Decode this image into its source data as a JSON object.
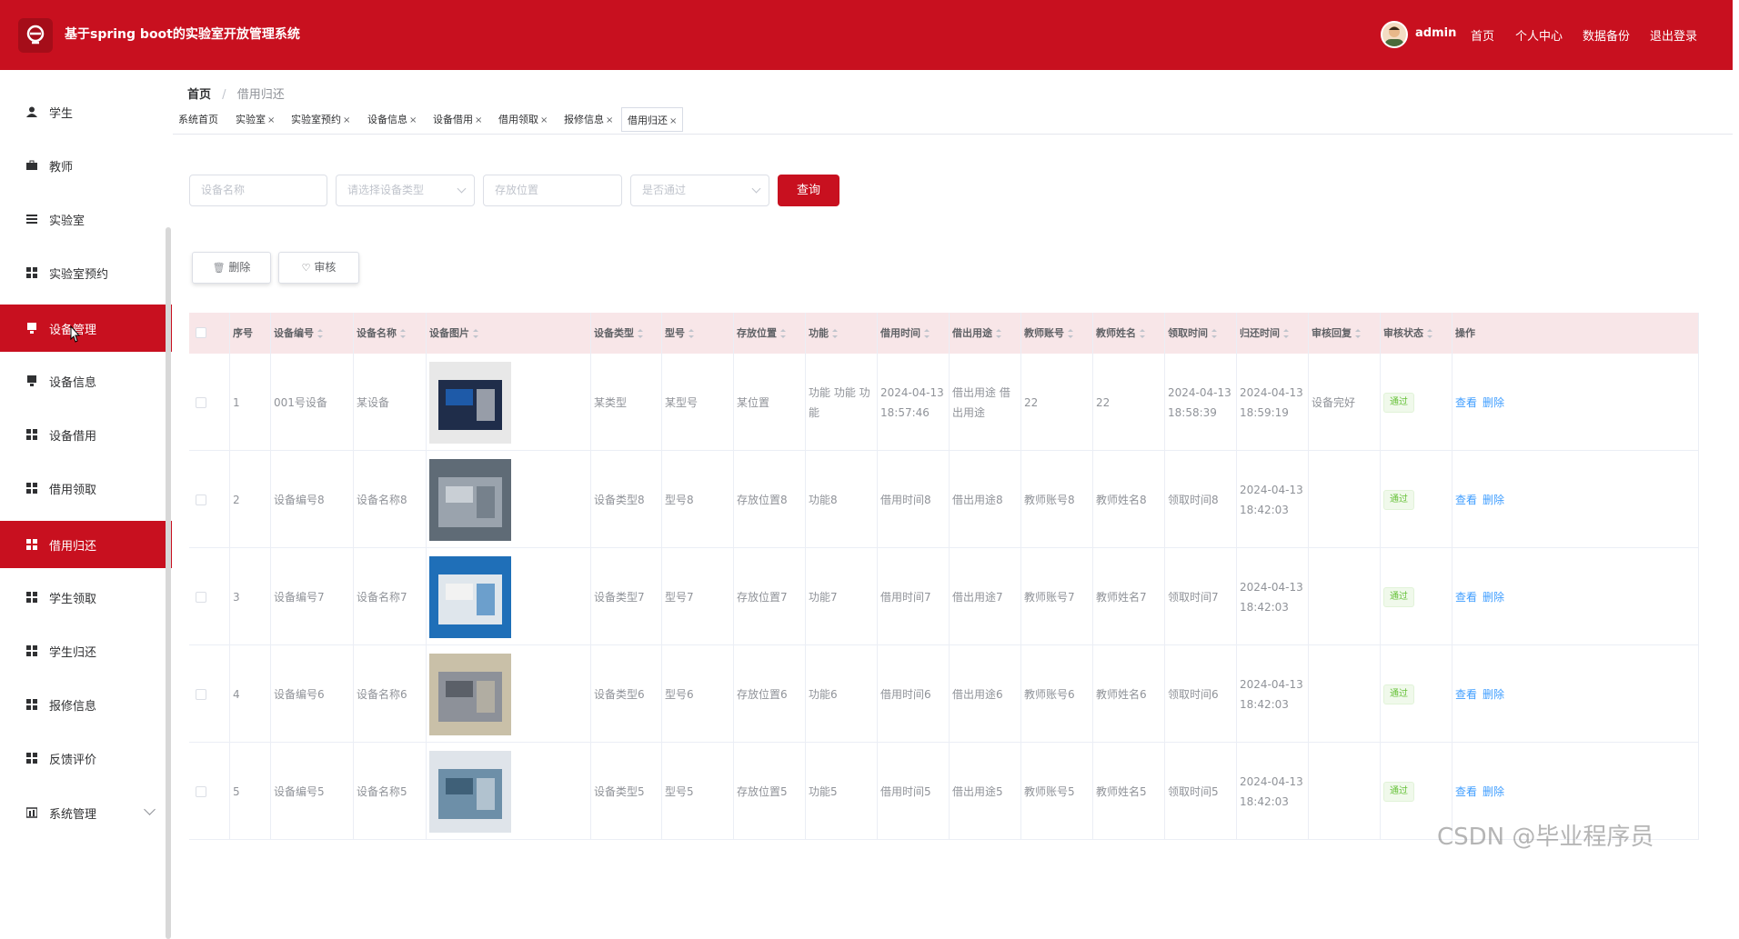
{
  "app_title": "基于spring boot的实验室开放管理系统",
  "header": {
    "username": "admin",
    "links": [
      "首页",
      "个人中心",
      "数据备份",
      "退出登录"
    ]
  },
  "sidebar": {
    "items": [
      {
        "label": "学生",
        "icon": "user-icon"
      },
      {
        "label": "教师",
        "icon": "briefcase-icon"
      },
      {
        "label": "实验室",
        "icon": "list-icon"
      },
      {
        "label": "实验室预约",
        "icon": "grid-icon"
      },
      {
        "label": "设备管理",
        "icon": "folder-icon",
        "active": true
      },
      {
        "label": "设备信息",
        "icon": "folder-icon"
      },
      {
        "label": "设备借用",
        "icon": "grid-icon"
      },
      {
        "label": "借用领取",
        "icon": "grid-icon"
      },
      {
        "label": "借用归还",
        "icon": "grid-icon",
        "active": true
      },
      {
        "label": "学生领取",
        "icon": "grid-icon"
      },
      {
        "label": "学生归还",
        "icon": "grid-icon"
      },
      {
        "label": "报修信息",
        "icon": "grid-icon"
      },
      {
        "label": "反馈评价",
        "icon": "grid-icon"
      },
      {
        "label": "系统管理",
        "icon": "chart-icon",
        "has_arrow": true
      }
    ]
  },
  "breadcrumb": {
    "home": "首页",
    "separator": "/",
    "current": "借用归还"
  },
  "tabs": [
    {
      "label": "系统首页",
      "closable": false
    },
    {
      "label": "实验室",
      "closable": true
    },
    {
      "label": "实验室预约",
      "closable": true
    },
    {
      "label": "设备信息",
      "closable": true
    },
    {
      "label": "设备借用",
      "closable": true
    },
    {
      "label": "借用领取",
      "closable": true
    },
    {
      "label": "报修信息",
      "closable": true
    },
    {
      "label": "借用归还",
      "closable": true,
      "active": true
    }
  ],
  "search": {
    "name_placeholder": "设备名称",
    "type_placeholder": "请选择设备类型",
    "location_placeholder": "存放位置",
    "approved_placeholder": "是否通过",
    "query_button": "查询"
  },
  "actions": {
    "delete": "删除",
    "review": "审核"
  },
  "table": {
    "columns": [
      "序号",
      "设备编号",
      "设备名称",
      "设备图片",
      "设备类型",
      "型号",
      "存放位置",
      "功能",
      "借用时间",
      "借出用途",
      "教师账号",
      "教师姓名",
      "领取时间",
      "归还时间",
      "审核回复",
      "审核状态",
      "操作"
    ],
    "rows": [
      {
        "index": "1",
        "code": "001号设备",
        "name": "某设备",
        "type": "某类型",
        "model": "某型号",
        "location": "某位置",
        "function": "功能 功能 功能",
        "borrow_time": "2024-04-13 18:57:46",
        "purpose": "借出用途 借出用途",
        "teacher_account": "22",
        "teacher_name": "22",
        "pickup_time": "2024-04-13 18:58:39",
        "return_time": "2024-04-13 18:59:19",
        "reply": "设备完好",
        "status": "通过",
        "view": "查看",
        "delete": "删除"
      },
      {
        "index": "2",
        "code": "设备编号8",
        "name": "设备名称8",
        "type": "设备类型8",
        "model": "型号8",
        "location": "存放位置8",
        "function": "功能8",
        "borrow_time": "借用时间8",
        "purpose": "借出用途8",
        "teacher_account": "教师账号8",
        "teacher_name": "教师姓名8",
        "pickup_time": "领取时间8",
        "return_time": "2024-04-13 18:42:03",
        "reply": "",
        "status": "通过",
        "view": "查看",
        "delete": "删除"
      },
      {
        "index": "3",
        "code": "设备编号7",
        "name": "设备名称7",
        "type": "设备类型7",
        "model": "型号7",
        "location": "存放位置7",
        "function": "功能7",
        "borrow_time": "借用时间7",
        "purpose": "借出用途7",
        "teacher_account": "教师账号7",
        "teacher_name": "教师姓名7",
        "pickup_time": "领取时间7",
        "return_time": "2024-04-13 18:42:03",
        "reply": "",
        "status": "通过",
        "view": "查看",
        "delete": "删除"
      },
      {
        "index": "4",
        "code": "设备编号6",
        "name": "设备名称6",
        "type": "设备类型6",
        "model": "型号6",
        "location": "存放位置6",
        "function": "功能6",
        "borrow_time": "借用时间6",
        "purpose": "借出用途6",
        "teacher_account": "教师账号6",
        "teacher_name": "教师姓名6",
        "pickup_time": "领取时间6",
        "return_time": "2024-04-13 18:42:03",
        "reply": "",
        "status": "通过",
        "view": "查看",
        "delete": "删除"
      },
      {
        "index": "5",
        "code": "设备编号5",
        "name": "设备名称5",
        "type": "设备类型5",
        "model": "型号5",
        "location": "存放位置5",
        "function": "功能5",
        "borrow_time": "借用时间5",
        "purpose": "借出用途5",
        "teacher_account": "教师账号5",
        "teacher_name": "教师姓名5",
        "pickup_time": "领取时间5",
        "return_time": "2024-04-13 18:42:03",
        "reply": "",
        "status": "通过",
        "view": "查看",
        "delete": "删除"
      }
    ]
  },
  "watermark": "CSDN @毕业程序员",
  "colors": {
    "primary": "#c8101f",
    "header_row": "#f8e6e8",
    "link": "#409eff",
    "success": "#67c23a"
  }
}
